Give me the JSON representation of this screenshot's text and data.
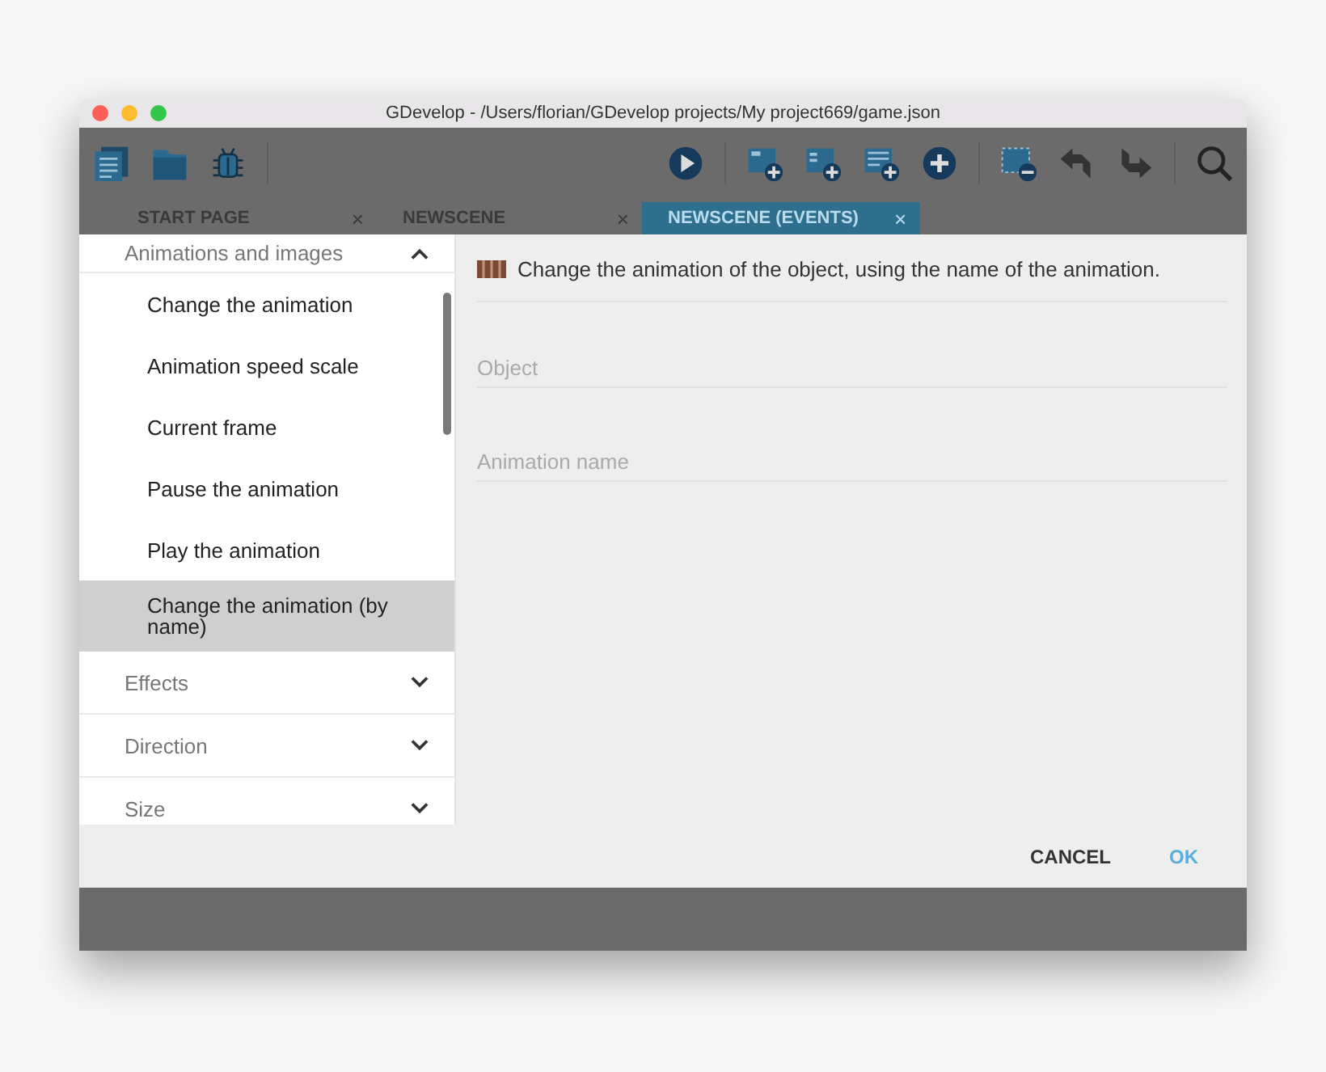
{
  "window": {
    "title": "GDevelop - /Users/florian/GDevelop projects/My project669/game.json"
  },
  "tabs": [
    {
      "label": "START PAGE",
      "close": "×",
      "selected": false
    },
    {
      "label": "NEWSCENE",
      "close": "×",
      "selected": false
    },
    {
      "label": "NEWSCENE (EVENTS)",
      "close": "×",
      "selected": true
    }
  ],
  "dialog": {
    "sidebar": {
      "groups": [
        {
          "label": "Animations and images",
          "expanded": true,
          "items": [
            {
              "label": "Change the animation",
              "selected": false
            },
            {
              "label": "Animation speed scale",
              "selected": false
            },
            {
              "label": "Current frame",
              "selected": false
            },
            {
              "label": "Pause the animation",
              "selected": false
            },
            {
              "label": "Play the animation",
              "selected": false
            },
            {
              "label": "Change the animation (by name)",
              "selected": true
            }
          ]
        },
        {
          "label": "Effects",
          "expanded": false
        },
        {
          "label": "Direction",
          "expanded": false
        },
        {
          "label": "Size",
          "expanded": false
        }
      ]
    },
    "description": "Change the animation of the object, using the name of the animation.",
    "fields": [
      {
        "placeholder": "Object"
      },
      {
        "placeholder": "Animation name"
      }
    ],
    "buttons": [
      {
        "label": "CANCEL",
        "kind": "secondary"
      },
      {
        "label": "OK",
        "kind": "primary"
      }
    ]
  }
}
